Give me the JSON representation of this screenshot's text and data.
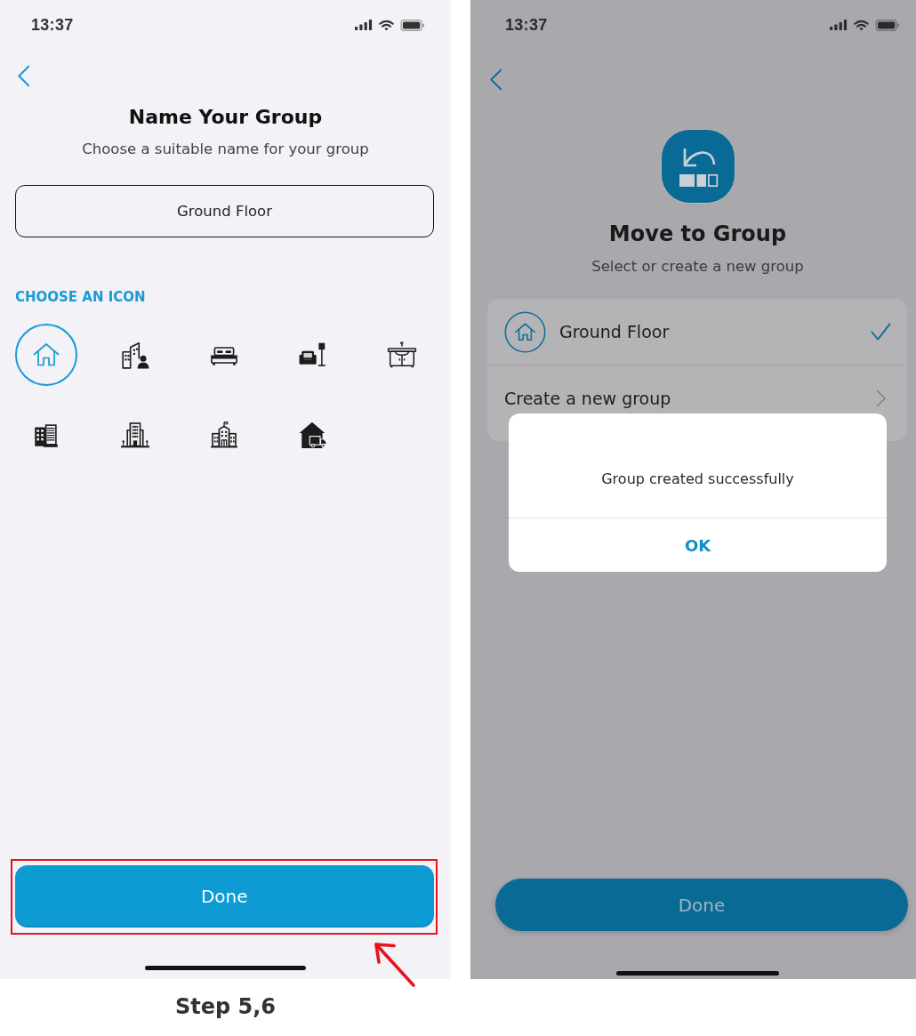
{
  "name_screen": {
    "status_bar": {
      "time": "13:37"
    },
    "title": "Name Your Group",
    "subtitle": "Choose a suitable name for your group",
    "name_field": {
      "value": "Ground Floor"
    },
    "icon_heading": "CHOOSE AN ICON",
    "icons": [
      {
        "selected": true
      },
      {
        "selected": false
      },
      {
        "selected": false
      },
      {
        "selected": false
      },
      {
        "selected": false
      },
      {
        "selected": false
      },
      {
        "selected": false
      },
      {
        "selected": false
      },
      {
        "selected": false
      }
    ],
    "done_button": "Done"
  },
  "caption": "Step 5,6",
  "move_screen": {
    "status_bar": {
      "time": "13:37"
    },
    "dimmed": true,
    "title": "Move to Group",
    "subtitle": "Select or create a new group",
    "groups": [
      {
        "kind": "group",
        "label": "Ground Floor",
        "selected": true
      },
      {
        "kind": "action",
        "label": "Create a new group",
        "selected": false
      }
    ],
    "dialog": {
      "message": "Group created successfully",
      "button": "OK"
    },
    "done_button": "Done"
  }
}
